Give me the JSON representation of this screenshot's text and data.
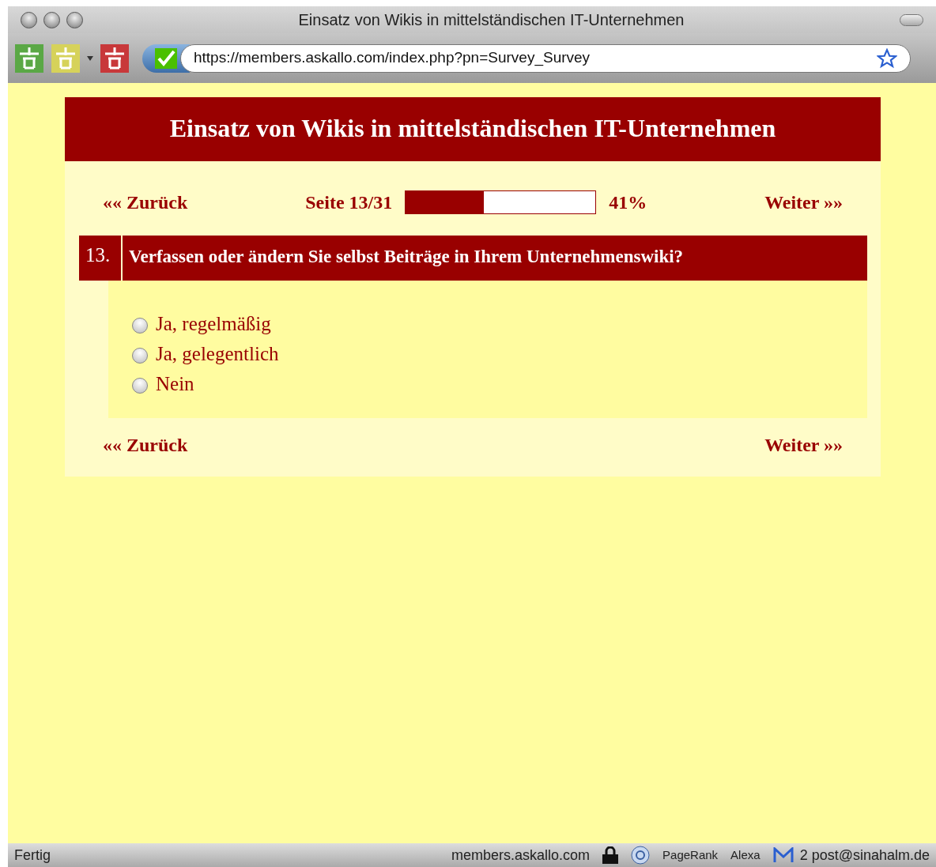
{
  "window": {
    "title": "Einsatz von Wikis in mittelständischen IT-Unternehmen"
  },
  "address_bar": {
    "url": "https://members.askallo.com/index.php?pn=Survey_Survey"
  },
  "page": {
    "heading": "Einsatz von Wikis in mittelständischen IT-Unternehmen",
    "top_nav": {
      "back": "«« Zurück",
      "page_label": "Seite 13/31",
      "progress": {
        "level": 0.41
      },
      "percent": "41%",
      "next": "Weiter »»"
    },
    "question": {
      "number": "13.",
      "text": "Verfassen oder ändern Sie selbst Beiträge in Ihrem Unternehmenswiki?",
      "options": [
        {
          "label": "Ja, regelmäßig",
          "selected": false
        },
        {
          "label": "Ja, gelegentlich",
          "selected": false
        },
        {
          "label": "Nein",
          "selected": false
        }
      ]
    },
    "bottom_nav": {
      "back": "«« Zurück",
      "next": "Weiter »»"
    }
  },
  "status_bar": {
    "status": "Fertig",
    "host": "members.askallo.com",
    "pagerank": "PageRank",
    "alexa": "Alexa",
    "mail": "2 post@sinahalm.de"
  }
}
